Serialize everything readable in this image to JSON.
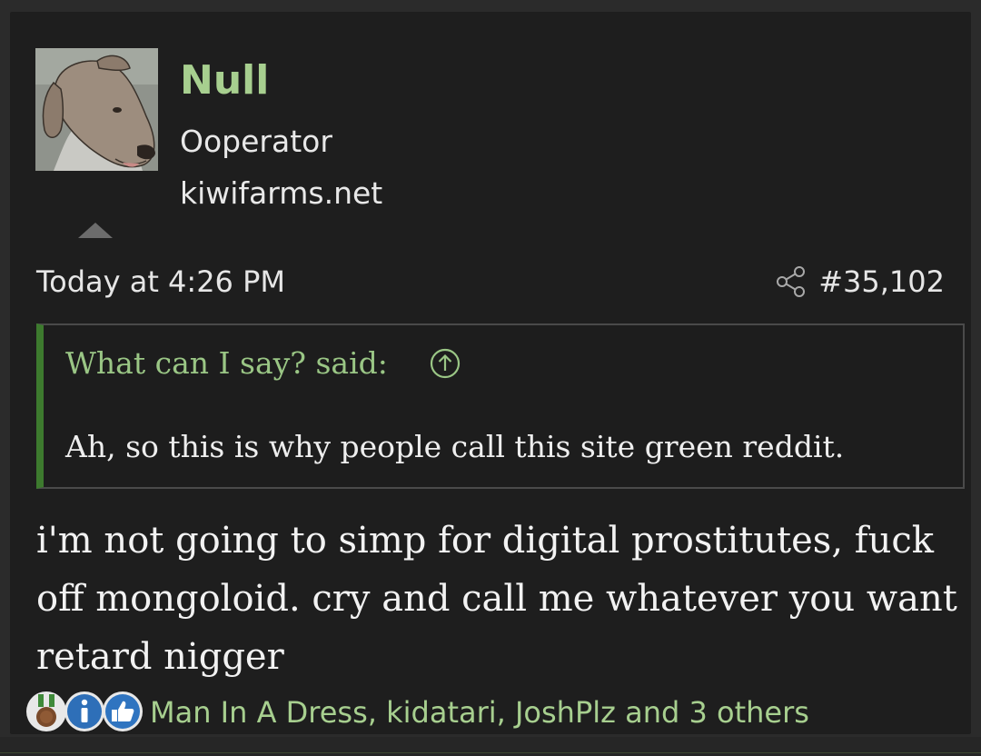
{
  "post": {
    "author": {
      "name": "Null",
      "title": "Ooperator",
      "site": "kiwifarms.net"
    },
    "date": "Today at 4:26 PM",
    "number": "#35,102",
    "quote": {
      "author_line": "What can I say? said:",
      "text": "Ah, so this is why people call this site green reddit."
    },
    "message": "i'm not going to simp for digital prostitutes, fuck off mongoloid. cry and call me whatever you want retard nigger",
    "reactions": {
      "icons": [
        "medal-icon",
        "info-icon",
        "thumbs-up-icon"
      ],
      "text": "Man In A Dress, kidatari, JoshPlz and 3 others"
    }
  },
  "colors": {
    "accent_green": "#a7cf8f",
    "quote_border": "#3d7a2e",
    "background": "#1e1e1e"
  }
}
